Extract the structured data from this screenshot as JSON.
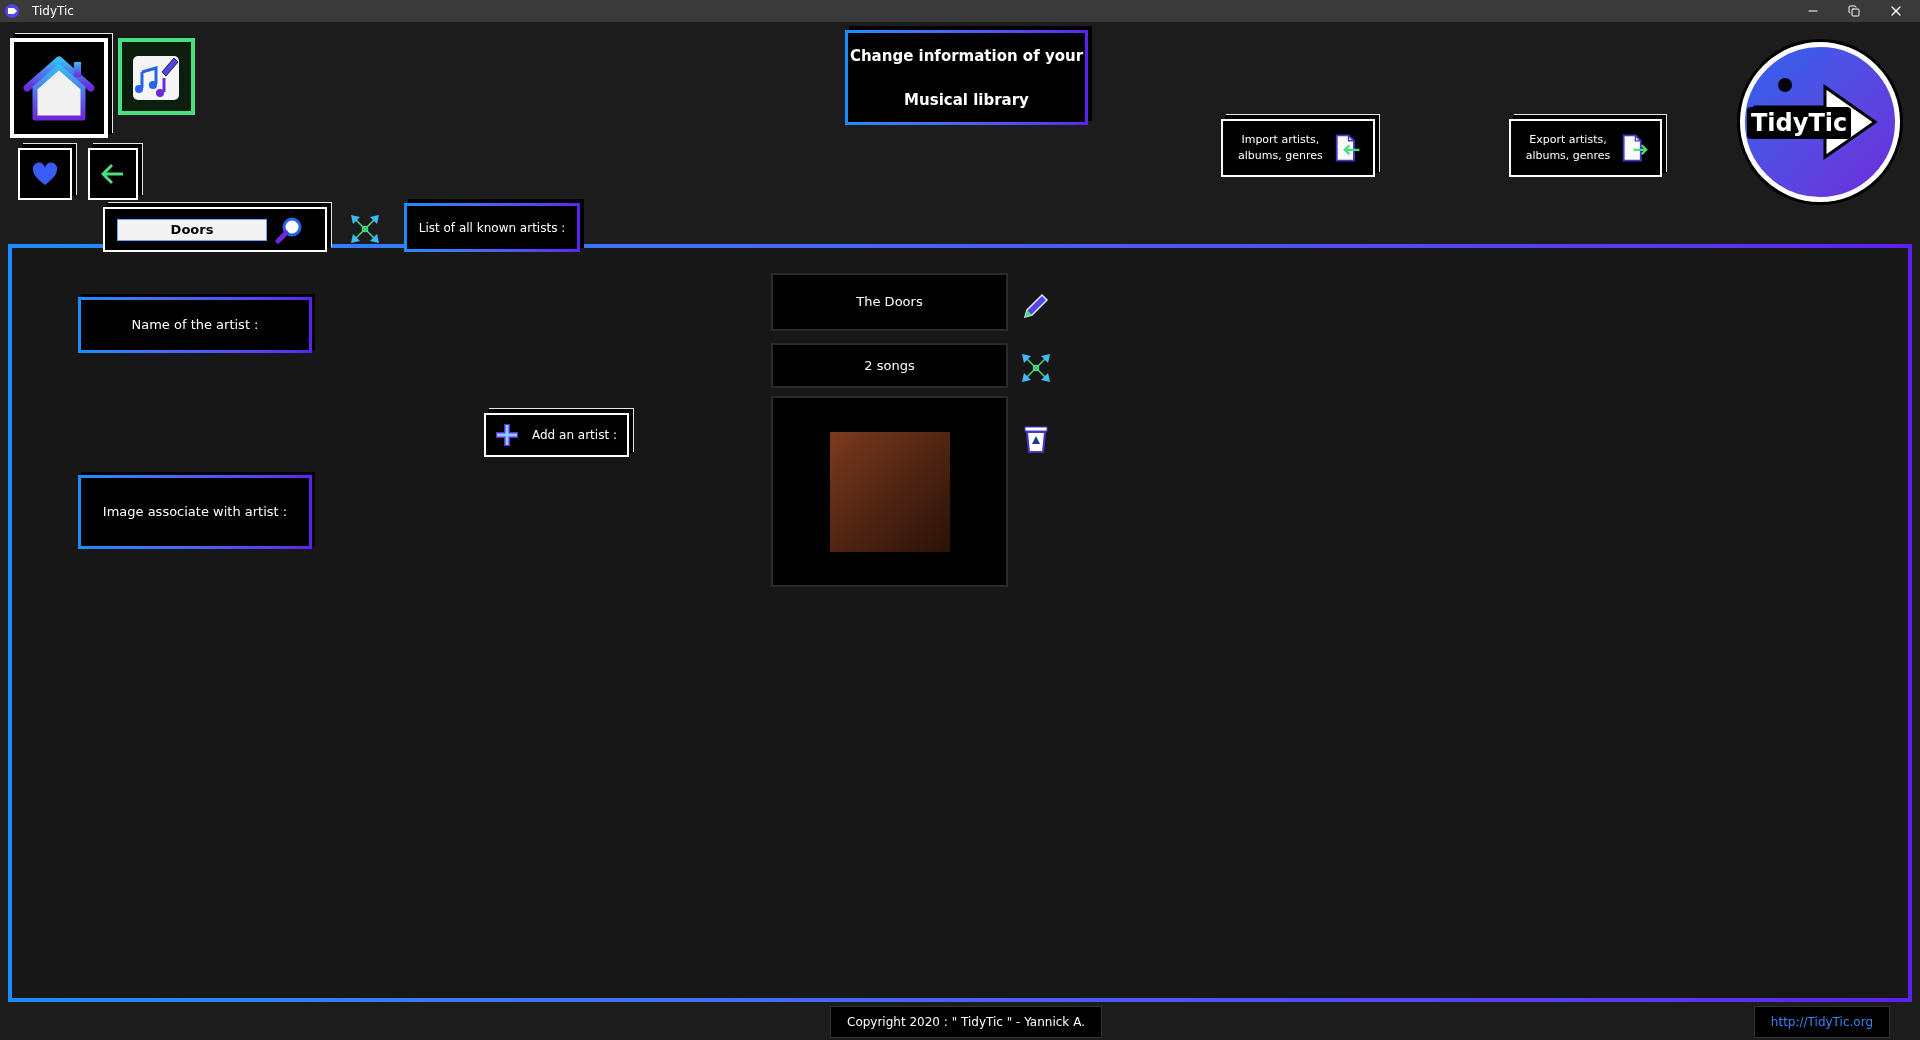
{
  "window": {
    "title": "TidyTic"
  },
  "header": {
    "title_lines": [
      "Change information of your",
      "Musical library"
    ]
  },
  "import_button": {
    "label": "Import artists, albums, genres"
  },
  "export_button": {
    "label": "Export artists, albums, genres"
  },
  "logo": {
    "text": "TidyTic"
  },
  "search": {
    "value": "Doors"
  },
  "list_tab": {
    "label": "List of all known artists :"
  },
  "form": {
    "name_label": "Name of the artist :",
    "image_label": "Image associate with artist :",
    "add_button": "Add an artist :"
  },
  "artist": {
    "name": "The Doors",
    "songs": "2 songs"
  },
  "footer": {
    "copyright": "Copyright 2020 : \" TidyTic \" - Yannick A.",
    "link": "http://TidyTic.org"
  }
}
